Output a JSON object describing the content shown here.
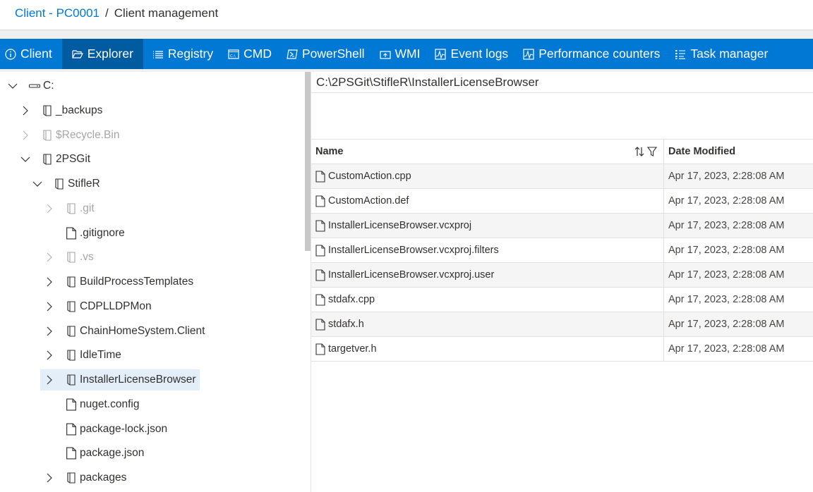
{
  "breadcrumb": {
    "parent": "Client - PC0001",
    "separator": "/",
    "current": "Client management"
  },
  "tabs": [
    {
      "label": "Client",
      "icon": "info-icon",
      "active": false
    },
    {
      "label": "Explorer",
      "icon": "folder-open-icon",
      "active": true
    },
    {
      "label": "Registry",
      "icon": "list-icon",
      "active": false
    },
    {
      "label": "CMD",
      "icon": "cmd-icon",
      "active": false
    },
    {
      "label": "PowerShell",
      "icon": "powershell-icon",
      "active": false
    },
    {
      "label": "WMI",
      "icon": "wmi-icon",
      "active": false
    },
    {
      "label": "Event logs",
      "icon": "chart-icon",
      "active": false
    },
    {
      "label": "Performance counters",
      "icon": "chart-icon",
      "active": false
    },
    {
      "label": "Task manager",
      "icon": "task-list-icon",
      "active": false
    }
  ],
  "tree": [
    {
      "label": "C:",
      "type": "drive",
      "level": 0,
      "expanded": true,
      "hasChildren": true,
      "dim": false,
      "selected": false
    },
    {
      "label": "_backups",
      "type": "folder",
      "level": 1,
      "expanded": false,
      "hasChildren": true,
      "dim": false,
      "selected": false
    },
    {
      "label": "$Recycle.Bin",
      "type": "folder",
      "level": 1,
      "expanded": false,
      "hasChildren": true,
      "dim": true,
      "selected": false
    },
    {
      "label": "2PSGit",
      "type": "folder",
      "level": 1,
      "expanded": true,
      "hasChildren": true,
      "dim": false,
      "selected": false
    },
    {
      "label": "StifleR",
      "type": "folder",
      "level": 2,
      "expanded": true,
      "hasChildren": true,
      "dim": false,
      "selected": false
    },
    {
      "label": ".git",
      "type": "folder",
      "level": 3,
      "expanded": false,
      "hasChildren": true,
      "dim": true,
      "selected": false
    },
    {
      "label": ".gitignore",
      "type": "file",
      "level": 3,
      "expanded": false,
      "hasChildren": false,
      "dim": false,
      "selected": false
    },
    {
      "label": ".vs",
      "type": "folder",
      "level": 3,
      "expanded": false,
      "hasChildren": true,
      "dim": true,
      "selected": false
    },
    {
      "label": "BuildProcessTemplates",
      "type": "folder",
      "level": 3,
      "expanded": false,
      "hasChildren": true,
      "dim": false,
      "selected": false
    },
    {
      "label": "CDPLLDPMon",
      "type": "folder",
      "level": 3,
      "expanded": false,
      "hasChildren": true,
      "dim": false,
      "selected": false
    },
    {
      "label": "ChainHomeSystem.Client",
      "type": "folder",
      "level": 3,
      "expanded": false,
      "hasChildren": true,
      "dim": false,
      "selected": false
    },
    {
      "label": "IdleTime",
      "type": "folder",
      "level": 3,
      "expanded": false,
      "hasChildren": true,
      "dim": false,
      "selected": false
    },
    {
      "label": "InstallerLicenseBrowser",
      "type": "folder",
      "level": 3,
      "expanded": false,
      "hasChildren": true,
      "dim": false,
      "selected": true
    },
    {
      "label": "nuget.config",
      "type": "file",
      "level": 3,
      "expanded": false,
      "hasChildren": false,
      "dim": false,
      "selected": false
    },
    {
      "label": "package-lock.json",
      "type": "file",
      "level": 3,
      "expanded": false,
      "hasChildren": false,
      "dim": false,
      "selected": false
    },
    {
      "label": "package.json",
      "type": "file",
      "level": 3,
      "expanded": false,
      "hasChildren": false,
      "dim": false,
      "selected": false
    },
    {
      "label": "packages",
      "type": "folder",
      "level": 3,
      "expanded": false,
      "hasChildren": true,
      "dim": false,
      "selected": false
    }
  ],
  "path": "C:\\2PSGit\\StifleR\\InstallerLicenseBrowser",
  "grid": {
    "columns": {
      "name": "Name",
      "date": "Date Modified"
    },
    "rows": [
      {
        "name": "CustomAction.cpp",
        "date": "Apr 17, 2023, 2:28:08 AM"
      },
      {
        "name": "CustomAction.def",
        "date": "Apr 17, 2023, 2:28:08 AM"
      },
      {
        "name": "InstallerLicenseBrowser.vcxproj",
        "date": "Apr 17, 2023, 2:28:08 AM"
      },
      {
        "name": "InstallerLicenseBrowser.vcxproj.filters",
        "date": "Apr 17, 2023, 2:28:08 AM"
      },
      {
        "name": "InstallerLicenseBrowser.vcxproj.user",
        "date": "Apr 17, 2023, 2:28:08 AM"
      },
      {
        "name": "stdafx.cpp",
        "date": "Apr 17, 2023, 2:28:08 AM"
      },
      {
        "name": "stdafx.h",
        "date": "Apr 17, 2023, 2:28:08 AM"
      },
      {
        "name": "targetver.h",
        "date": "Apr 17, 2023, 2:28:08 AM"
      }
    ]
  },
  "colors": {
    "accent": "#0078d4",
    "active_tab": "#005ba1",
    "selected_row": "#e4eef8"
  }
}
